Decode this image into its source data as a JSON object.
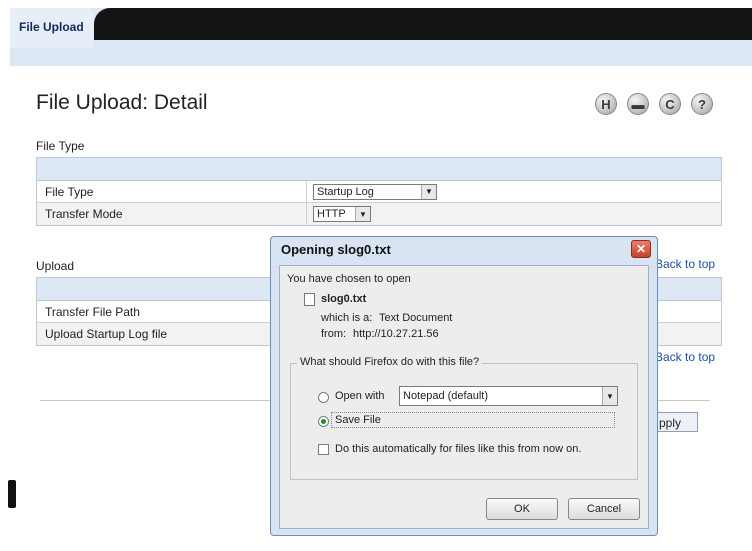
{
  "tabs": {
    "active": "File Upload"
  },
  "page": {
    "title": "File Upload: Detail"
  },
  "toolbar": {
    "save_glyph": "H",
    "print_glyph": "▬",
    "refresh_glyph": "C",
    "help_glyph": "?"
  },
  "file_type_section": {
    "label": "File Type",
    "rows": [
      {
        "label": "File Type",
        "value": "Startup Log"
      },
      {
        "label": "Transfer Mode",
        "value": "HTTP"
      }
    ]
  },
  "upload_section": {
    "label": "Upload",
    "rows": [
      {
        "label": "Transfer File Path"
      },
      {
        "label": "Upload Startup Log file"
      }
    ]
  },
  "links": {
    "back_to_top": "Back to top"
  },
  "apply_button": "pply",
  "dialog": {
    "title": "Opening slog0.txt",
    "close": "✕",
    "intro": "You have chosen to open",
    "file_name": "slog0.txt",
    "which_is_label": "which is a:",
    "which_is_value": "Text Document",
    "from_label": "from:",
    "from_value": "http://10.27.21.56",
    "question": "What should Firefox do with this file?",
    "open_with_label": "Open with",
    "open_with_app": "Notepad (default)",
    "save_file_label": "Save File",
    "auto_label": "Do this automatically for files like this from now on.",
    "selected_option": "Save File",
    "ok": "OK",
    "cancel": "Cancel"
  }
}
